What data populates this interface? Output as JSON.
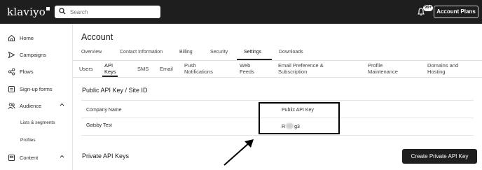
{
  "topbar": {
    "logo": "klaviyo",
    "search_placeholder": "Search",
    "notification_count": "99+",
    "account_plans_label": "Account Plans"
  },
  "sidebar": {
    "items": [
      {
        "label": "Home",
        "icon": "home-icon"
      },
      {
        "label": "Campaigns",
        "icon": "campaigns-icon"
      },
      {
        "label": "Flows",
        "icon": "flows-icon"
      },
      {
        "label": "Sign-up forms",
        "icon": "signup-forms-icon"
      },
      {
        "label": "Audience",
        "icon": "audience-icon"
      },
      {
        "label": "Content",
        "icon": "content-icon"
      }
    ],
    "audience_sub": [
      "Lists & segments",
      "Profiles"
    ]
  },
  "page": {
    "title": "Account",
    "tabs": [
      "Overview",
      "Contact Information",
      "Billing",
      "Security",
      "Settings",
      "Downloads"
    ],
    "active_tab": "Settings",
    "subtabs": [
      [
        "Users"
      ],
      [
        "API",
        "Keys"
      ],
      [
        "SMS"
      ],
      [
        "Email"
      ],
      [
        "Push",
        "Notifications"
      ],
      [
        "Web",
        "Feeds"
      ],
      [
        "Email Preference &",
        "Subscription"
      ],
      [
        "Profile",
        "Maintenance"
      ],
      [
        "Domains and",
        "Hosting"
      ]
    ],
    "active_subtab": "API Keys"
  },
  "public_keys": {
    "section_title": "Public API Key / Site ID",
    "col_company": "Company Name",
    "col_key": "Public API Key",
    "company_value": "Gatsby Test",
    "key_prefix": "R",
    "key_suffix": "g3"
  },
  "private_keys": {
    "section_title": "Private API Keys",
    "create_button": "Create Private API Key"
  },
  "colors": {
    "topbar_bg": "#1e1e1e",
    "button_bg": "#1e1e1e",
    "highlight_border": "#000000"
  }
}
